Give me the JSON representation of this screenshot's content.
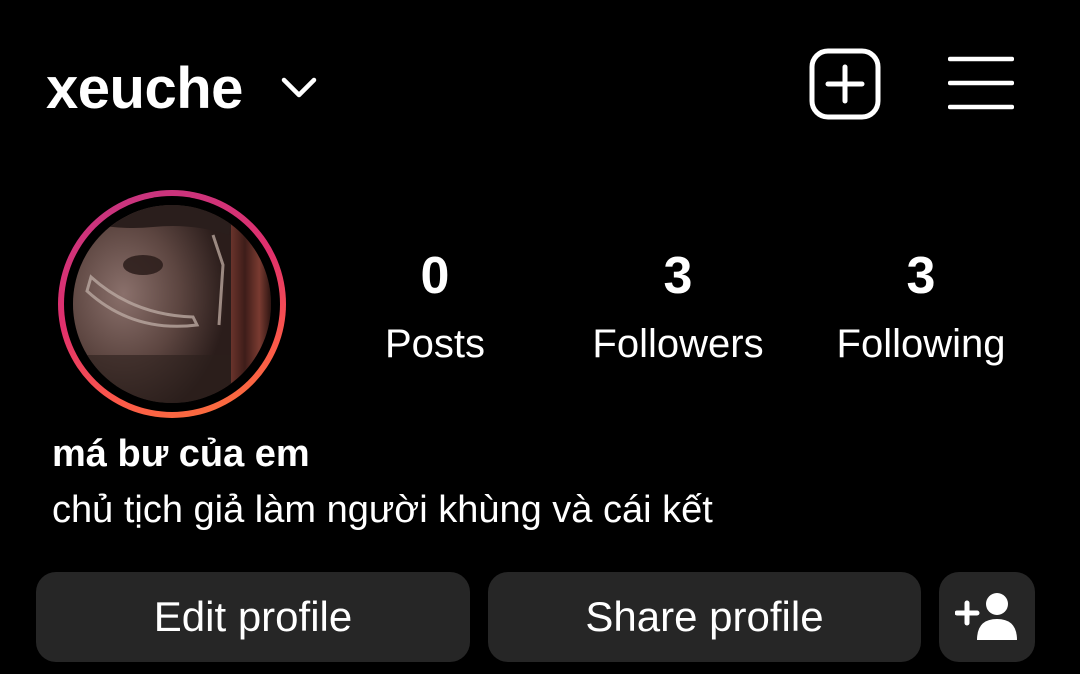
{
  "header": {
    "username": "xeuche"
  },
  "profile": {
    "display_name": "má bư của em",
    "bio": "chủ tịch giả làm người khùng và cái kết",
    "story_ring_colors": [
      "#c13584",
      "#e1306c",
      "#fd5949",
      "#f77737"
    ]
  },
  "stats": [
    {
      "value": "0",
      "label": "Posts"
    },
    {
      "value": "3",
      "label": "Followers"
    },
    {
      "value": "3",
      "label": "Following"
    }
  ],
  "actions": {
    "edit_label": "Edit profile",
    "share_label": "Share profile",
    "add_user_icon": "add-person-icon"
  },
  "icons": {
    "username_dropdown": "chevron-down-icon",
    "new_post": "plus-square-icon",
    "menu": "hamburger-menu-icon"
  },
  "colors": {
    "background": "#000000",
    "text": "#ffffff",
    "button_bg": "#262626"
  }
}
